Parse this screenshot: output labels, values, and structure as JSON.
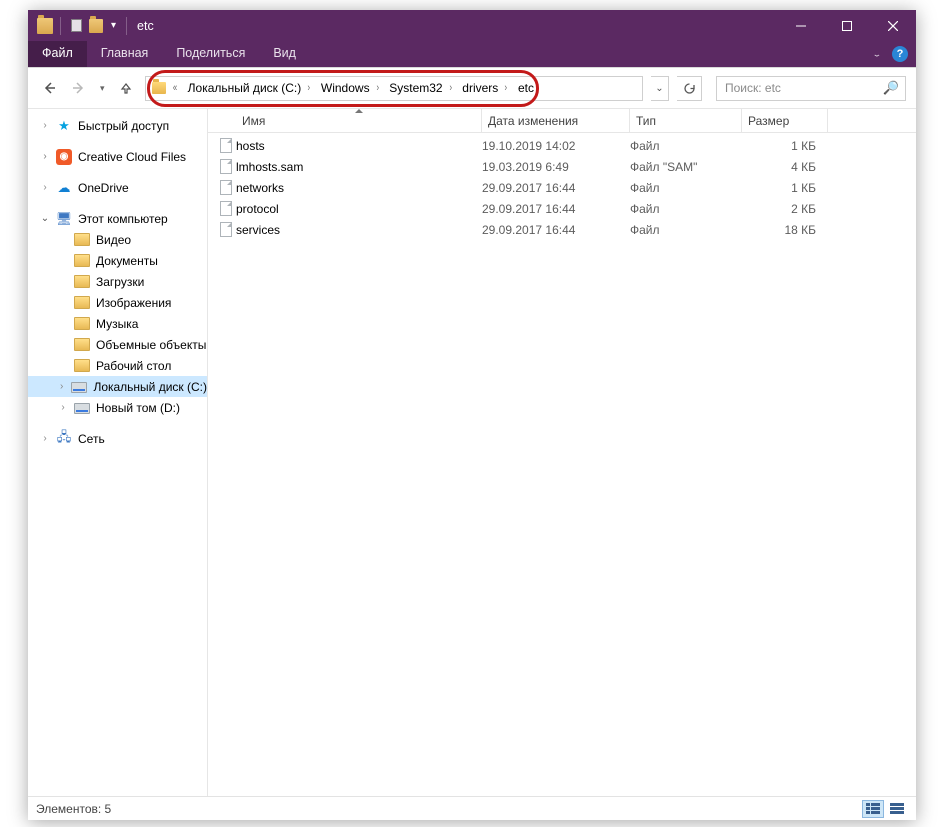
{
  "window": {
    "title": "etc"
  },
  "ribbon": {
    "file": "Файл",
    "home": "Главная",
    "share": "Поделиться",
    "view": "Вид"
  },
  "breadcrumb": {
    "seg0": "Локальный диск (C:)",
    "seg1": "Windows",
    "seg2": "System32",
    "seg3": "drivers",
    "seg4": "etc"
  },
  "search": {
    "placeholder": "Поиск: etc"
  },
  "sidebar": {
    "quick": "Быстрый доступ",
    "cc": "Creative Cloud Files",
    "onedrive": "OneDrive",
    "thispc": "Этот компьютер",
    "videos": "Видео",
    "documents": "Документы",
    "downloads": "Загрузки",
    "pictures": "Изображения",
    "music": "Музыка",
    "objects3d": "Объемные объекты",
    "desktop": "Рабочий стол",
    "drive_c": "Локальный диск (C:)",
    "drive_d": "Новый том (D:)",
    "network": "Сеть"
  },
  "columns": {
    "name": "Имя",
    "date": "Дата изменения",
    "type": "Тип",
    "size": "Размер"
  },
  "files": [
    {
      "name": "hosts",
      "date": "19.10.2019 14:02",
      "type": "Файл",
      "size": "1 КБ"
    },
    {
      "name": "lmhosts.sam",
      "date": "19.03.2019 6:49",
      "type": "Файл \"SAM\"",
      "size": "4 КБ"
    },
    {
      "name": "networks",
      "date": "29.09.2017 16:44",
      "type": "Файл",
      "size": "1 КБ"
    },
    {
      "name": "protocol",
      "date": "29.09.2017 16:44",
      "type": "Файл",
      "size": "2 КБ"
    },
    {
      "name": "services",
      "date": "29.09.2017 16:44",
      "type": "Файл",
      "size": "18 КБ"
    }
  ],
  "status": {
    "count": "Элементов: 5"
  }
}
